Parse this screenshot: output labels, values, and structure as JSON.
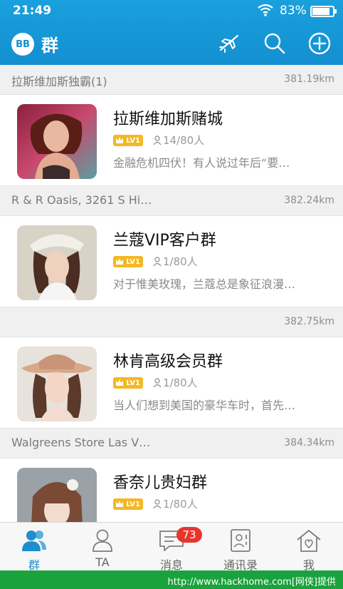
{
  "status_bar": {
    "time": "21:49",
    "battery": "83%"
  },
  "header": {
    "logo": "BB",
    "title": "群"
  },
  "groups": [
    {
      "place": "拉斯维加斯独霸(1)",
      "distance": "381.19km",
      "name": "拉斯维加斯赌城",
      "level": "LV1",
      "members": "14/80人",
      "desc": "金融危机四伏！有人说过年后“要…"
    },
    {
      "place": "R & R Oasis, 3261 S Hi…",
      "distance": "382.24km",
      "name": "兰蔻VIP客户群",
      "level": "LV1",
      "members": "1/80人",
      "desc": "对于惟美玫瑰，兰蔻总是象征浪漫…"
    },
    {
      "place": "",
      "distance": "382.75km",
      "name": "林肯高级会员群",
      "level": "LV1",
      "members": "1/80人",
      "desc": "当人们想到美国的豪华车时，首先…"
    },
    {
      "place": "Walgreens Store Las V…",
      "distance": "384.34km",
      "name": "香奈儿贵妇群",
      "level": "LV1",
      "members": "1/80人",
      "desc": ""
    }
  ],
  "tabs": [
    {
      "label": "群",
      "icon": "group-icon"
    },
    {
      "label": "TA",
      "icon": "person-icon"
    },
    {
      "label": "消息",
      "icon": "message-icon",
      "badge": "73"
    },
    {
      "label": "通讯录",
      "icon": "contacts-icon"
    },
    {
      "label": "我",
      "icon": "home-icon"
    }
  ],
  "watermark": "http://www.hackhome.com[网侠]提供",
  "colors": {
    "header": "#138fd0",
    "badge": "#e8352c",
    "level": "#f4b822",
    "active_tab": "#1b8fcf"
  }
}
